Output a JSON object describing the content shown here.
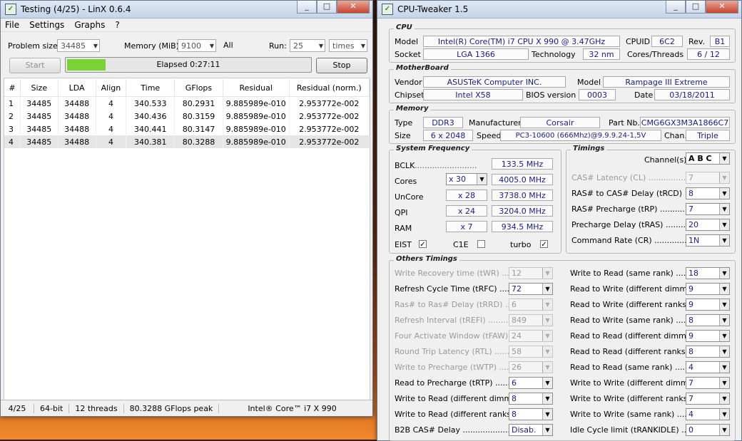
{
  "linx": {
    "title": "Testing (4/25) - LinX 0.6.4",
    "menu": [
      "File",
      "Settings",
      "Graphs",
      "?"
    ],
    "problem_size_label": "Problem size:",
    "problem_size": "34485",
    "memory_label": "Memory (MiB):",
    "memory": "9100",
    "all_label": "All",
    "run_label": "Run:",
    "runs": "25",
    "times": "times",
    "start_label": "Start",
    "elapsed": "Elapsed 0:27:11",
    "stop_label": "Stop",
    "columns": [
      "#",
      "Size",
      "LDA",
      "Align",
      "Time",
      "GFlops",
      "Residual",
      "Residual (norm.)"
    ],
    "rows": [
      [
        "1",
        "34485",
        "34488",
        "4",
        "340.533",
        "80.2931",
        "9.885989e-010",
        "2.953772e-002"
      ],
      [
        "2",
        "34485",
        "34488",
        "4",
        "340.436",
        "80.3159",
        "9.885989e-010",
        "2.953772e-002"
      ],
      [
        "3",
        "34485",
        "34488",
        "4",
        "340.441",
        "80.3147",
        "9.885989e-010",
        "2.953772e-002"
      ],
      [
        "4",
        "34485",
        "34488",
        "4",
        "340.381",
        "80.3288",
        "9.885989e-010",
        "2.953772e-002"
      ]
    ],
    "status": {
      "progress": "4/25",
      "bits": "64-bit",
      "threads": "12 threads",
      "peak": "80.3288 GFlops peak",
      "cpu": "Intel® Core™ i7 X 990"
    },
    "progress_color": "#7ad335"
  },
  "tweaker": {
    "title": "CPU-Tweaker 1.5",
    "cpu": {
      "group": "CPU",
      "model_label": "Model",
      "model": "Intel(R) Core(TM) i7 CPU       X 990  @ 3.47GHz",
      "cpuid_label": "CPUID",
      "cpuid": "6C2",
      "rev_label": "Rev.",
      "rev": "B1",
      "socket_label": "Socket",
      "socket": "LGA 1366",
      "tech_label": "Technology",
      "tech": "32 nm",
      "cores_label": "Cores/Threads",
      "cores": "6 / 12"
    },
    "mb": {
      "group": "MotherBoard",
      "vendor_label": "Vendor",
      "vendor": "ASUSTeK Computer INC.",
      "model_label": "Model",
      "model": "Rampage III Extreme",
      "chipset_label": "Chipset",
      "chipset": "Intel X58",
      "bios_label": "BIOS version",
      "bios": "0003",
      "date_label": "Date",
      "date": "03/18/2011"
    },
    "mem": {
      "group": "Memory",
      "type_label": "Type",
      "type": "DDR3",
      "manu_label": "Manufacturer",
      "manu": "Corsair",
      "part_label": "Part Nb.",
      "part": "CMG6GX3M3A1866C7",
      "size_label": "Size",
      "size": "6 x 2048",
      "speed_label": "Speed",
      "speed": "PC3-10600 (666Mhz)@9.9.9.24-1,5V",
      "chan_label": "Chan.",
      "chan": "Triple"
    },
    "freq": {
      "group": "System Frequency",
      "bclk_label": "BCLK",
      "bclk": "133.5 MHz",
      "cores_label": "Cores",
      "cores_mult": "x 30",
      "cores_freq": "4005.0 MHz",
      "uncore_label": "UnCore",
      "uncore_mult": "x 28",
      "uncore_freq": "3738.0 MHz",
      "qpi_label": "QPI",
      "qpi_mult": "x 24",
      "qpi_freq": "3204.0 MHz",
      "ram_label": "RAM",
      "ram_mult": "x 7",
      "ram_freq": "934.5 MHz",
      "eist_label": "EIST",
      "c1e_label": "C1E",
      "turbo_label": "turbo"
    },
    "timings": {
      "group": "Timings",
      "channels_label": "Channel(s)",
      "channels": "A B C",
      "items": [
        {
          "label": "CAS# Latency (CL) ..................",
          "value": "7",
          "disabled": true
        },
        {
          "label": "RAS# to CAS# Delay (tRCD)",
          "value": "8",
          "disabled": false
        },
        {
          "label": "RAS# Precharge (tRP) ..............",
          "value": "7",
          "disabled": false
        },
        {
          "label": "Precharge Delay (tRAS) .........",
          "value": "20",
          "disabled": false
        },
        {
          "label": "Command Rate (CR) ................",
          "value": "1N",
          "disabled": false
        }
      ]
    },
    "others": {
      "group": "Others Timings",
      "left": [
        {
          "label": "Write Recovery time (tWR) ........",
          "value": "12",
          "disabled": true
        },
        {
          "label": "Refresh Cycle Time (tRFC) .......",
          "value": "72",
          "disabled": false
        },
        {
          "label": "Ras# to Ras# Delay (tRRD) .......",
          "value": "6",
          "disabled": true
        },
        {
          "label": "Refresh Interval (tREFI) ...........",
          "value": "849",
          "disabled": true
        },
        {
          "label": "Four Activate Window (tFAW) ...",
          "value": "24",
          "disabled": true
        },
        {
          "label": "Round Trip Latency (RTL) ........",
          "value": "58",
          "disabled": true
        },
        {
          "label": "Write to Precharge (tWTP) ........",
          "value": "26",
          "disabled": true
        },
        {
          "label": "Read to Precharge (tRTP) ........",
          "value": "6",
          "disabled": false
        },
        {
          "label": "Write to Read (different dimms) .",
          "value": "8",
          "disabled": false
        },
        {
          "label": "Write to Read (different ranks) ..",
          "value": "8",
          "disabled": false
        },
        {
          "label": "B2B CAS# Delay ......................",
          "value": "Disab.",
          "disabled": false
        }
      ],
      "right": [
        {
          "label": "Write to Read (same rank) ..........",
          "value": "18",
          "disabled": false
        },
        {
          "label": "Read to Write (different dimms) ..",
          "value": "9",
          "disabled": false
        },
        {
          "label": "Read to Write (different ranks) ...",
          "value": "9",
          "disabled": false
        },
        {
          "label": "Read to Write (same rank) ...........",
          "value": "8",
          "disabled": false
        },
        {
          "label": "Read to Read (different dimms) ..",
          "value": "9",
          "disabled": false
        },
        {
          "label": "Read to Read (different ranks) ...",
          "value": "8",
          "disabled": false
        },
        {
          "label": "Read to Read (same rank) ...........",
          "value": "4",
          "disabled": false
        },
        {
          "label": "Write to Write (different dimms) .",
          "value": "7",
          "disabled": false
        },
        {
          "label": "Write to Write (different ranks) ..",
          "value": "7",
          "disabled": false
        },
        {
          "label": "Write to Write (same rank) ..........",
          "value": "4",
          "disabled": false
        },
        {
          "label": "Idle Cycle limit (tRANKIDLE) ......",
          "value": "0",
          "disabled": false
        }
      ]
    }
  }
}
